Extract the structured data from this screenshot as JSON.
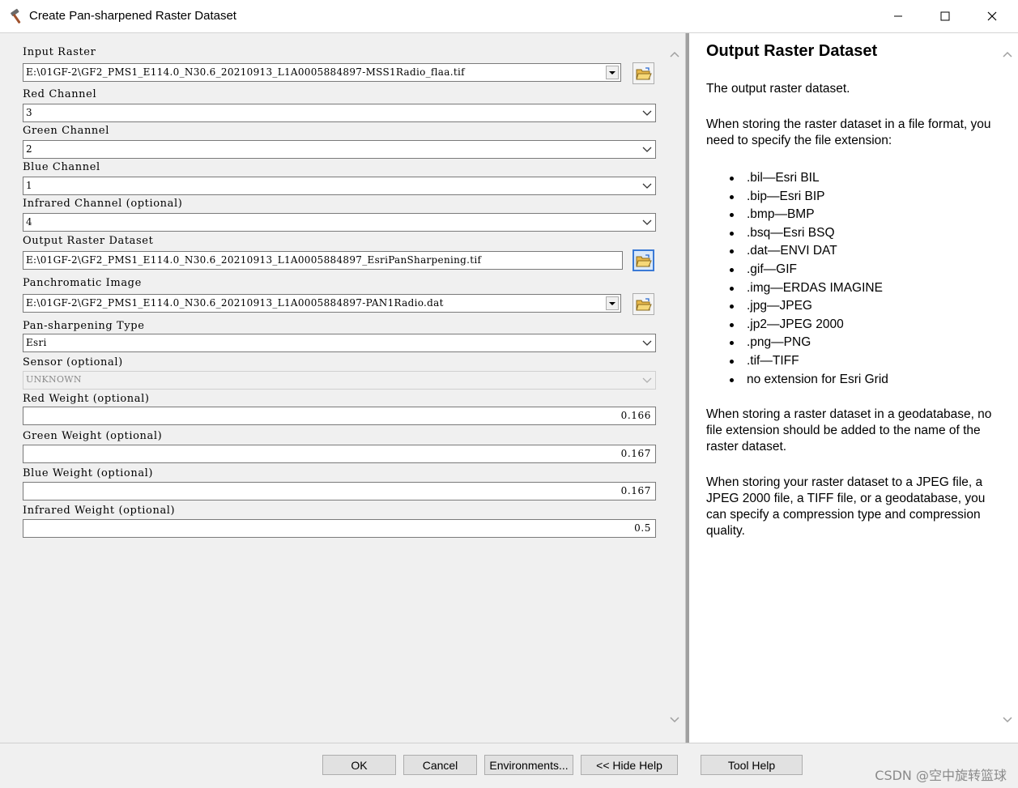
{
  "window": {
    "title": "Create Pan-sharpened Raster Dataset",
    "icon": "hammer-icon",
    "controls": [
      "minimize-icon",
      "maximize-icon",
      "close-icon"
    ]
  },
  "form": {
    "input_raster": {
      "label": "Input Raster",
      "value": "E:\\01GF-2\\GF2_PMS1_E114.0_N30.6_20210913_L1A0005884897-MSS1Radio_flaa.tif"
    },
    "red_channel": {
      "label": "Red Channel",
      "value": "3"
    },
    "green_channel": {
      "label": "Green Channel",
      "value": "2"
    },
    "blue_channel": {
      "label": "Blue Channel",
      "value": "1"
    },
    "infrared_channel": {
      "label": "Infrared Channel (optional)",
      "value": "4"
    },
    "output_raster": {
      "label": "Output Raster Dataset",
      "value": "E:\\01GF-2\\GF2_PMS1_E114.0_N30.6_20210913_L1A0005884897_EsriPanSharpening.tif"
    },
    "panchromatic": {
      "label": "Panchromatic Image",
      "value": "E:\\01GF-2\\GF2_PMS1_E114.0_N30.6_20210913_L1A0005884897-PAN1Radio.dat"
    },
    "pan_type": {
      "label": "Pan-sharpening Type",
      "value": "Esri"
    },
    "sensor": {
      "label": "Sensor (optional)",
      "value": "UNKNOWN"
    },
    "red_weight": {
      "label": "Red Weight (optional)",
      "value": "0.166"
    },
    "green_weight": {
      "label": "Green Weight (optional)",
      "value": "0.167"
    },
    "blue_weight": {
      "label": "Blue Weight (optional)",
      "value": "0.167"
    },
    "infrared_weight": {
      "label": "Infrared Weight (optional)",
      "value": "0.5"
    }
  },
  "help": {
    "title": "Output Raster Dataset",
    "p1": "The output raster dataset.",
    "p2": "When storing the raster dataset in a file format, you need to specify the file extension:",
    "extensions": [
      ".bil—Esri BIL",
      ".bip—Esri BIP",
      ".bmp—BMP",
      ".bsq—Esri BSQ",
      ".dat—ENVI DAT",
      ".gif—GIF",
      ".img—ERDAS IMAGINE",
      ".jpg—JPEG",
      ".jp2—JPEG 2000",
      ".png—PNG",
      ".tif—TIFF",
      "no extension for Esri Grid"
    ],
    "p3": "When storing a raster dataset in a geodatabase, no file extension should be added to the name of the raster dataset.",
    "p4": "When storing your raster dataset to a JPEG file, a JPEG 2000 file, a TIFF file, or a geodatabase, you can specify a compression type and compression quality."
  },
  "buttons": {
    "ok": "OK",
    "cancel": "Cancel",
    "environments": "Environments...",
    "hide_help": "<< Hide Help",
    "tool_help": "Tool Help"
  },
  "watermark": "CSDN @空中旋转篮球"
}
